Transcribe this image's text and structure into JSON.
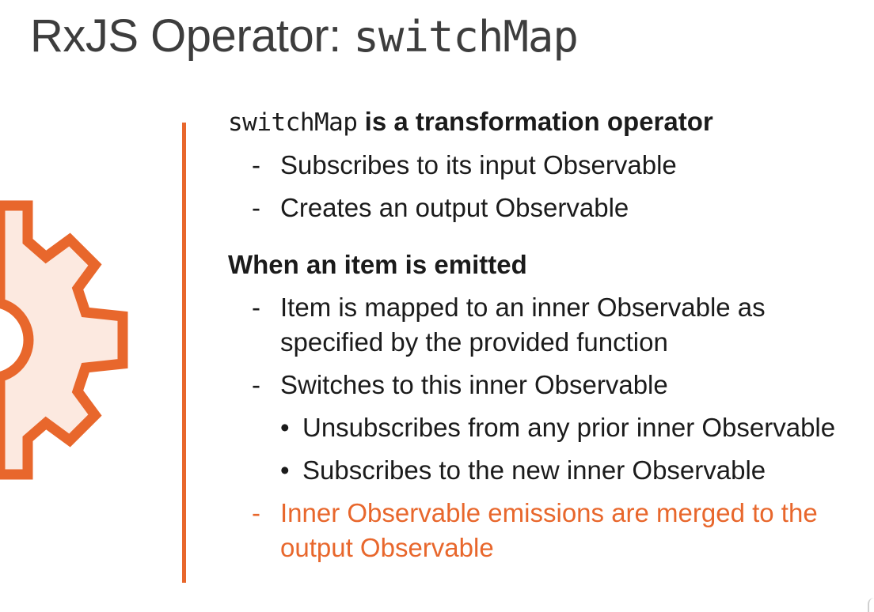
{
  "slide": {
    "title_prefix": "RxJS Operator: ",
    "title_code": "switchMap"
  },
  "illustration": {
    "icon": "gear-icon",
    "stroke_color": "#E8672C",
    "fill_color": "#FCE9E0"
  },
  "divider_color": "#E8672C",
  "section1": {
    "heading_code": "switchMap",
    "heading_text": " is a transformation operator",
    "items": [
      {
        "marker": "-",
        "text": "Subscribes to its input Observable"
      },
      {
        "marker": "-",
        "text": "Creates an output Observable"
      }
    ]
  },
  "section2": {
    "heading": "When an item is emitted",
    "items": [
      {
        "marker": "-",
        "text": "Item is mapped to an inner Observable as specified by the provided function"
      },
      {
        "marker": "-",
        "text": "Switches to this inner Observable"
      }
    ],
    "subitems": [
      {
        "marker": "•",
        "text": "Unsubscribes from any prior inner Observable"
      },
      {
        "marker": "•",
        "text": "Subscribes to the new inner Observable"
      }
    ],
    "final_item": {
      "marker": "-",
      "text": "Inner Observable emissions are merged to the output Observable",
      "color": "#E8672C"
    }
  }
}
